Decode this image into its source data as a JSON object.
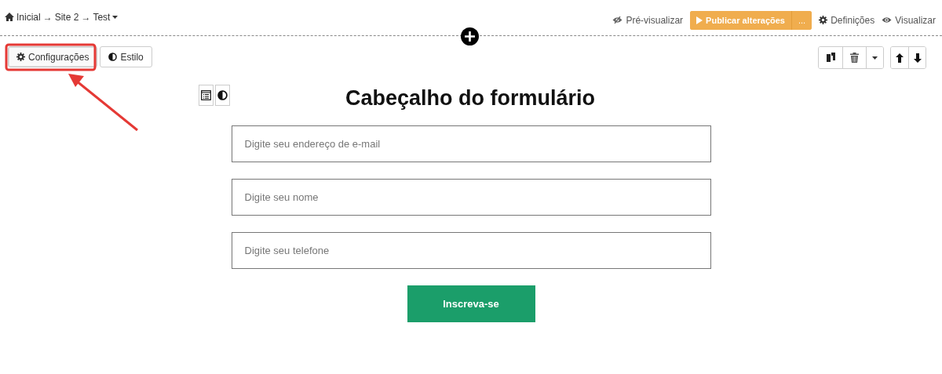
{
  "breadcrumb": [
    "Inicial",
    "Site 2",
    "Test"
  ],
  "breadcrumb_separator": "→",
  "top_actions": {
    "preview": "Pré-visualizar",
    "publish": "Publicar alterações",
    "publish_more": "...",
    "settings": "Definições",
    "view": "Visualizar"
  },
  "panel_tabs": [
    {
      "label": "Configurações",
      "selected": true
    },
    {
      "label": "Estilo",
      "selected": false
    }
  ],
  "form": {
    "title": "Cabeçalho do formulário",
    "fields": [
      {
        "placeholder": "Digite seu endereço de e-mail"
      },
      {
        "placeholder": "Digite seu nome"
      },
      {
        "placeholder": "Digite seu telefone"
      }
    ],
    "submit": "Inscreva-se"
  }
}
